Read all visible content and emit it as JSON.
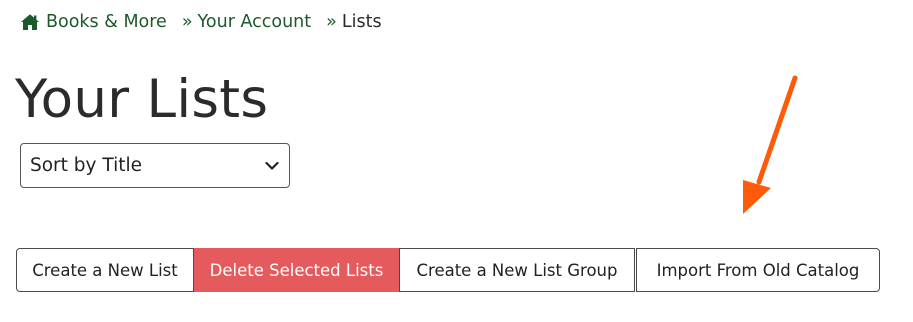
{
  "breadcrumb": {
    "home_label": "Books & More",
    "separator": "»",
    "account_label": "Your Account",
    "current_label": "Lists",
    "home_icon": "home-icon"
  },
  "page_title": "Your Lists",
  "sort": {
    "selected": "Sort by Title",
    "icon": "chevron-down-icon"
  },
  "actions": {
    "create_list": "Create a New List",
    "delete_selected": "Delete Selected Lists",
    "create_group": "Create a New List Group",
    "import_old": "Import From Old Catalog"
  },
  "colors": {
    "link": "#1c5a2a",
    "danger": "#e55a5c",
    "annotation_arrow": "#ff5a0a"
  }
}
